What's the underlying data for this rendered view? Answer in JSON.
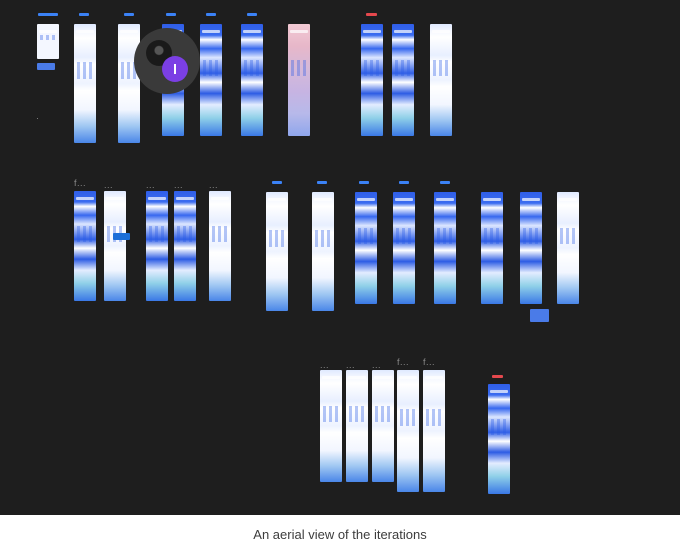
{
  "canvas": {
    "frame_labels": {
      "r2_c1": "f...",
      "r2_c2": "...",
      "r2_c3": "...",
      "r2_c4": "...",
      "r2_c5": "...",
      "r3_c1": "...",
      "r3_c2": "...",
      "r3_c3": "...",
      "r3_c4": "f...",
      "r3_c5": "f..."
    }
  },
  "cursor": {
    "avatar_icon": "user-avatar-icon",
    "badge_icon": "text-cursor-icon",
    "badge_color": "#7b3fe4"
  },
  "colors": {
    "canvas_bg": "#1e1e1e",
    "tag_blue": "#3b82f6",
    "tag_red": "#e5484d"
  },
  "caption": "An aerial view of the iterations"
}
